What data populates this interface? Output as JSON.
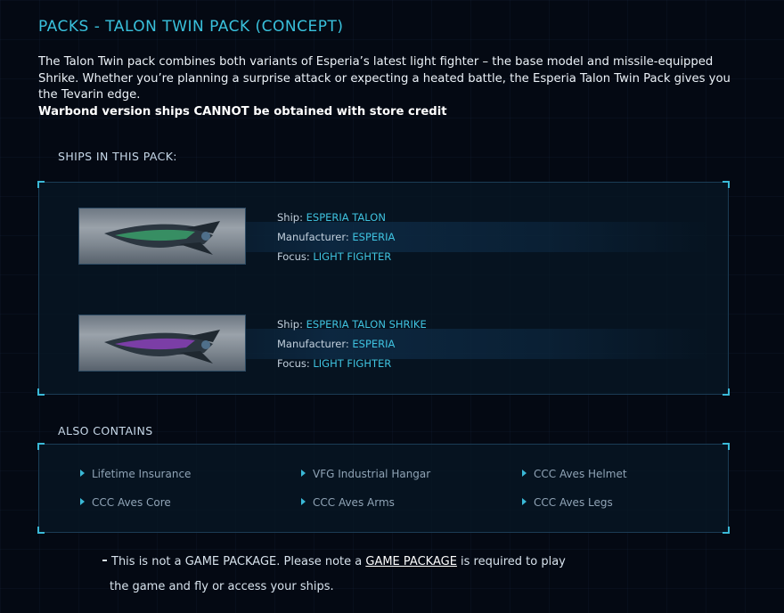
{
  "title": "PACKS - TALON TWIN PACK (CONCEPT)",
  "description": {
    "text": "The Talon Twin pack combines both variants of Esperia’s latest light fighter – the base model and missile-equipped Shrike. Whether you’re planning a surprise attack or expecting a heated battle, the Esperia Talon Twin Pack gives you the Tevarin edge.",
    "warning": "Warbond version ships CANNOT be obtained with store credit"
  },
  "ships_section": {
    "heading": "SHIPS IN THIS PACK:",
    "labels": {
      "ship": "Ship:",
      "manufacturer": "Manufacturer:",
      "focus": "Focus:"
    },
    "ships": [
      {
        "name": "ESPERIA TALON",
        "manufacturer": "ESPERIA",
        "focus": "LIGHT FIGHTER",
        "accent": "#3a9e6a"
      },
      {
        "name": "ESPERIA TALON SHRIKE",
        "manufacturer": "ESPERIA",
        "focus": "LIGHT FIGHTER",
        "accent": "#8a3fb8"
      }
    ]
  },
  "also_contains": {
    "heading": "ALSO CONTAINS",
    "items": [
      "Lifetime Insurance",
      "VFG Industrial Hangar",
      "CCC Aves Helmet",
      "CCC Aves Core",
      "CCC Aves Arms",
      "CCC Aves Legs"
    ]
  },
  "footer": {
    "prefix": "This is not a GAME PACKAGE. Please note a ",
    "link": "GAME PACKAGE",
    "suffix": " is required to play",
    "line2": "the game and fly or access your ships."
  },
  "colors": {
    "accent": "#39c1dc",
    "background": "#040913"
  },
  "icons": {
    "bullet": "triangle-bullet-icon"
  }
}
